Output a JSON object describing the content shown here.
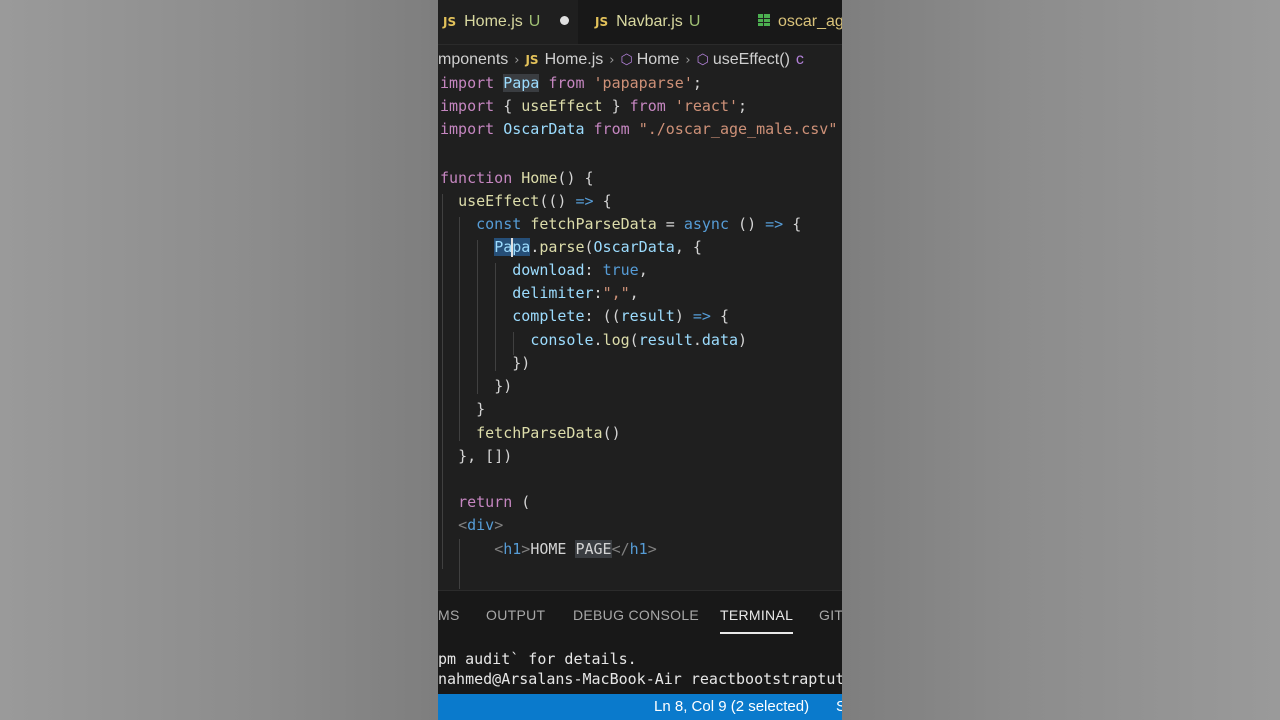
{
  "tabs": [
    {
      "icon": "JS",
      "title": "Home.js",
      "status": "U",
      "modified": true,
      "active": true
    },
    {
      "icon": "JS",
      "title": "Navbar.js",
      "status": "U",
      "modified": false,
      "active": false
    },
    {
      "icon": "table",
      "title": "oscar_ag",
      "status": "",
      "modified": false,
      "active": false
    }
  ],
  "breadcrumb": {
    "folder": "mponents",
    "file_icon": "JS",
    "file": "Home.js",
    "symbol1": "Home",
    "symbol2": "useEffect()",
    "symbol2_trail": "c"
  },
  "code_lines": [
    "import Papa from 'papaparse';",
    "import { useEffect } from 'react';",
    "import OscarData from \"./oscar_age_male.csv\"",
    "",
    "function Home() {",
    "  useEffect(() => {",
    "    const fetchParseData = async () => {",
    "      Papa.parse(OscarData, {",
    "        download: true,",
    "        delimiter:\",\",",
    "        complete: ((result) => {",
    "          console.log(result.data)",
    "        })",
    "      })",
    "    }",
    "    fetchParseData()",
    "  }, [])",
    "",
    "  return (",
    "  <div>",
    "      <h1>HOME PAGE</h1>"
  ],
  "panel": {
    "tabs": [
      "MS",
      "OUTPUT",
      "DEBUG CONSOLE",
      "TERMINAL",
      "GIT"
    ],
    "active_tab": "TERMINAL",
    "terminal_lines": [
      "pm audit` for details.",
      "nahmed@Arsalans-MacBook-Air reactbootstraptuto"
    ]
  },
  "statusbar": {
    "position": "Ln 8, Col 9 (2 selected)",
    "edge": "S"
  },
  "colors": {
    "editor_bg": "#1f1f1f",
    "statusbar_bg": "#0a7acc",
    "keyword": "#c586c0",
    "function": "#dcdcaa",
    "variable": "#9cdcfe",
    "string": "#ce9178"
  }
}
